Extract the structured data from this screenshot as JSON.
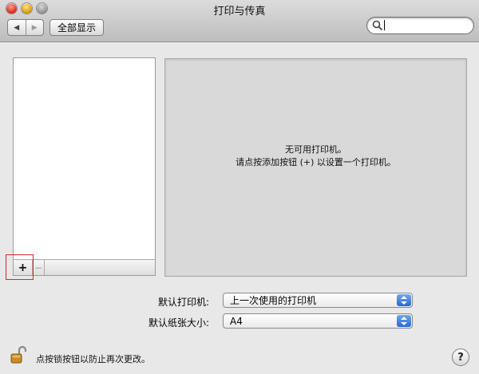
{
  "window": {
    "title": "打印与传真"
  },
  "toolbar": {
    "back_label": "◀",
    "forward_label": "▶",
    "show_all_label": "全部显示",
    "search_value": "",
    "search_placeholder": ""
  },
  "printer_list": {
    "items": [],
    "add_label": "+",
    "remove_label": "−"
  },
  "detail": {
    "empty_line1": "无可用打印机。",
    "empty_line2": "请点按添加按钮 (+) 以设置一个打印机。"
  },
  "settings": {
    "default_printer_label": "默认打印机:",
    "default_printer_value": "上一次使用的打印机",
    "default_paper_label": "默认纸张大小:",
    "default_paper_value": "A4"
  },
  "footer": {
    "lock_text": "点按锁按钮以防止再次更改。",
    "help_label": "?"
  },
  "colors": {
    "highlight_border": "#e0232b",
    "select_accent": "#2668d6"
  }
}
